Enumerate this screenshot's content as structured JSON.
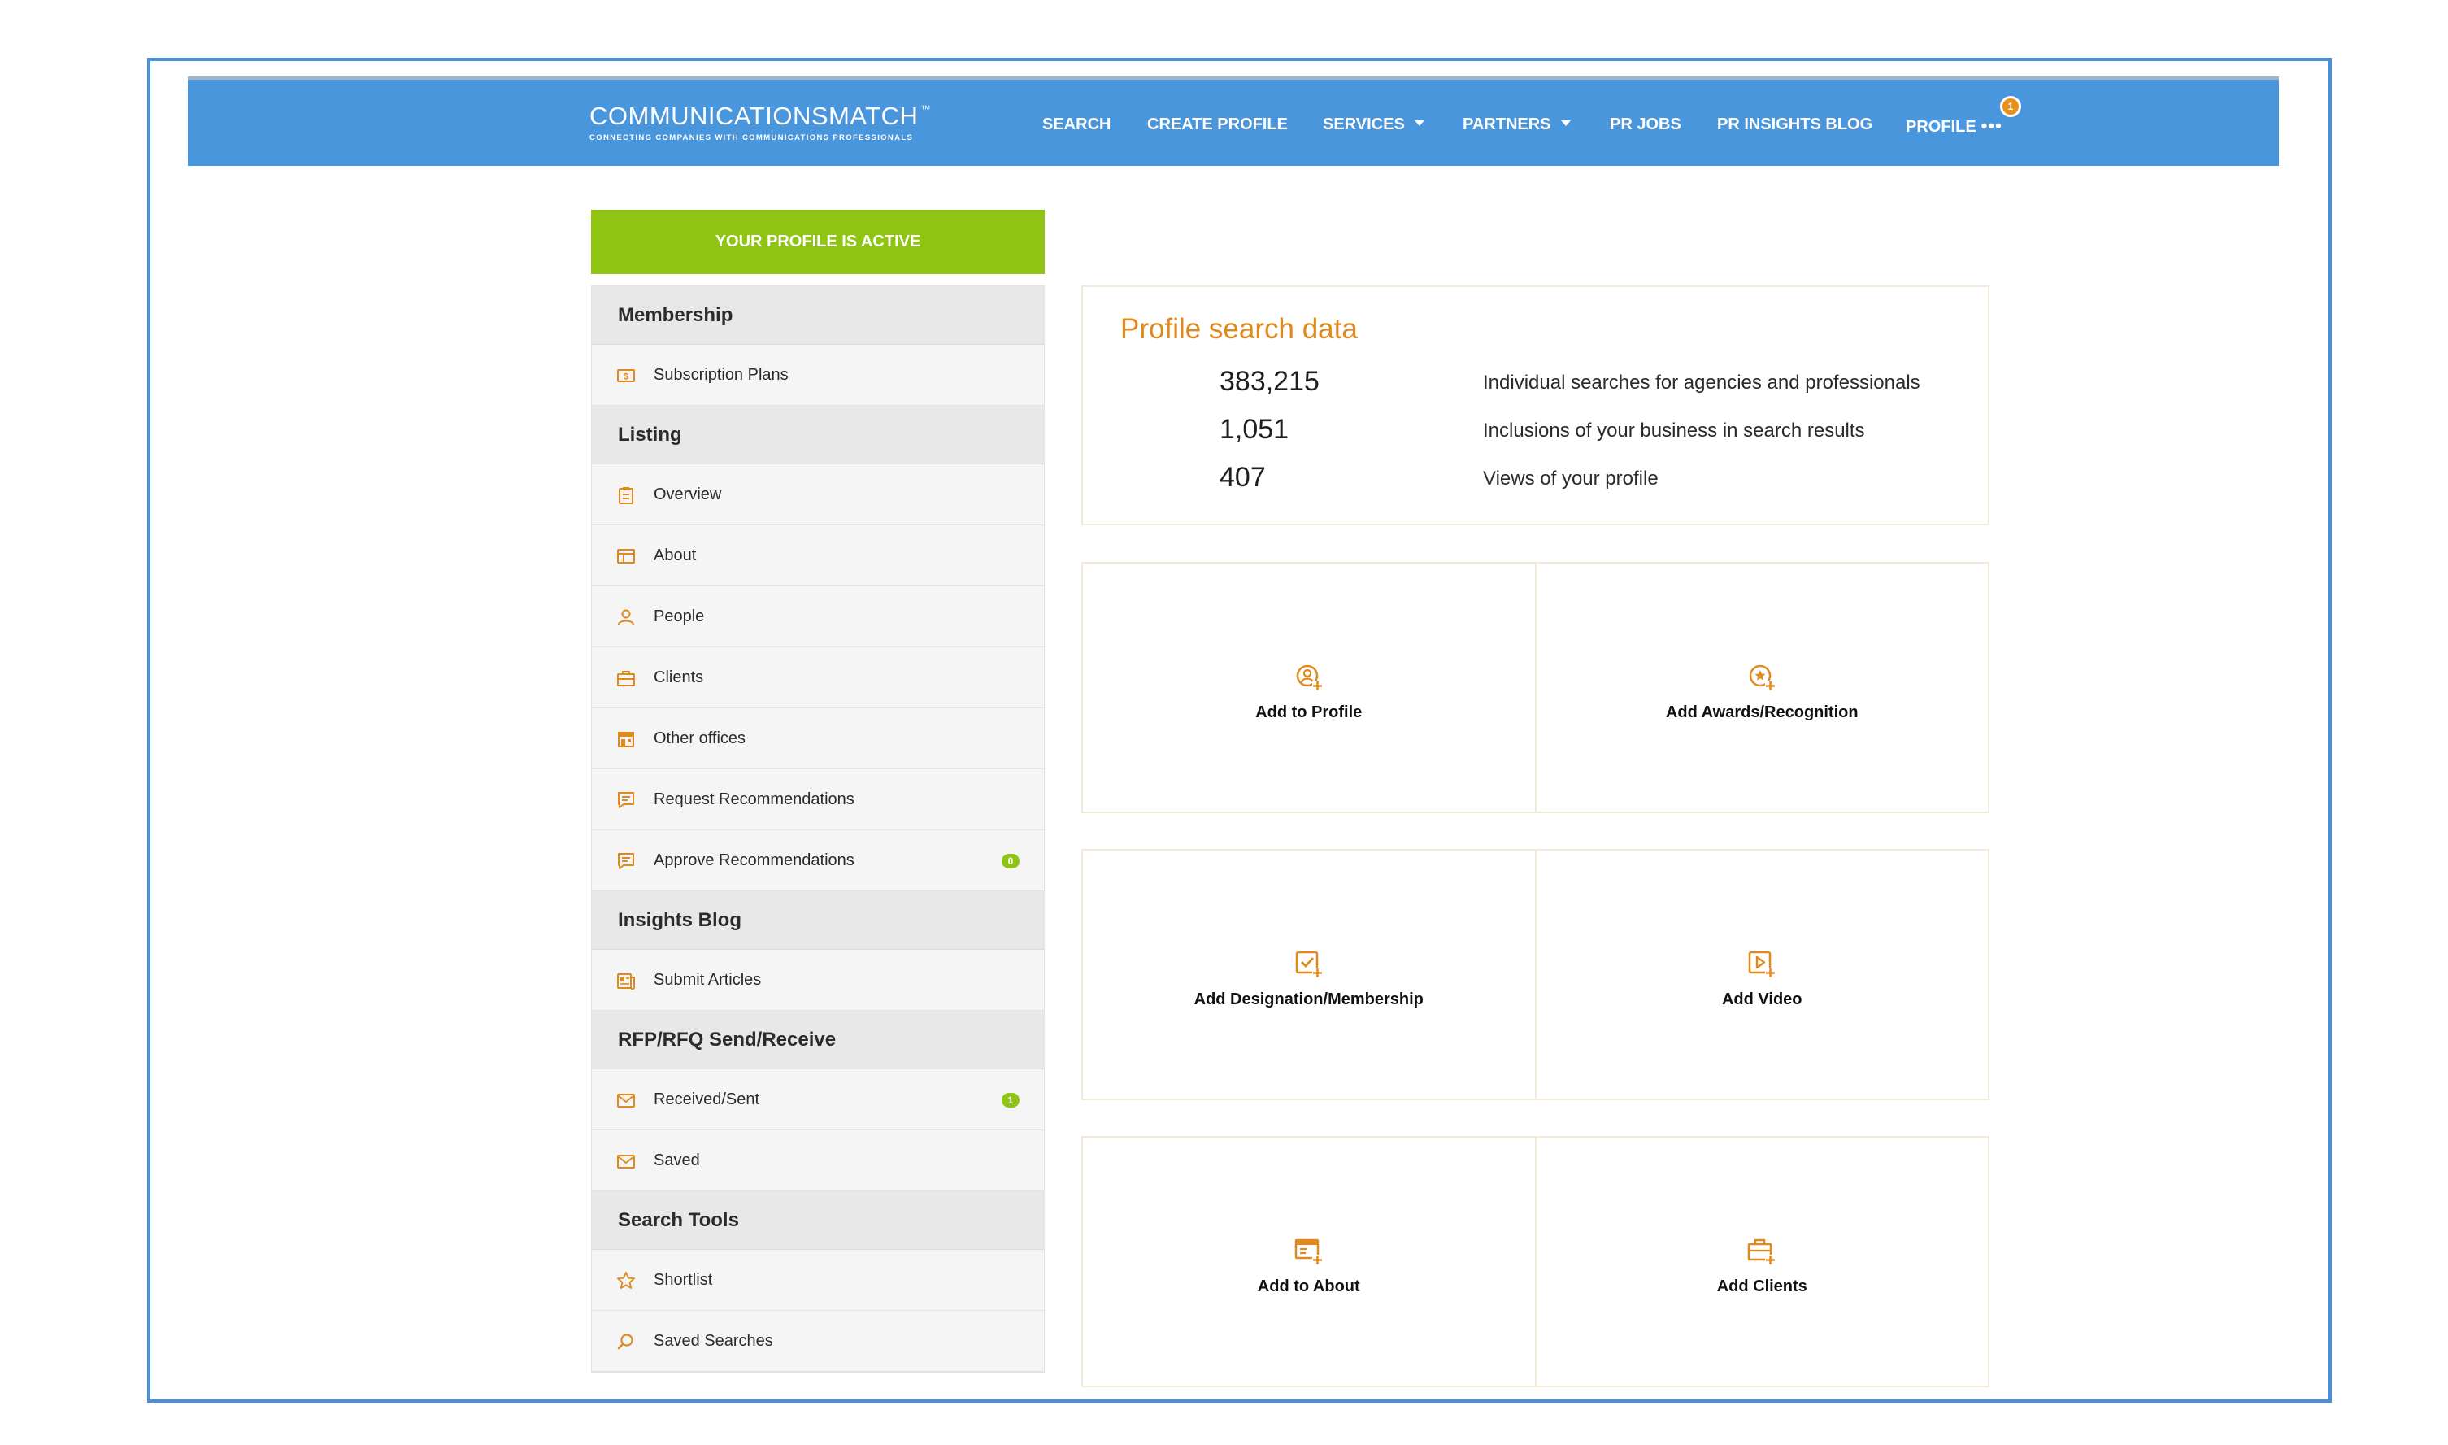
{
  "header": {
    "logo_text": "COMMUNICATIONSMATCH",
    "logo_tm": "™",
    "logo_tagline": "CONNECTING COMPANIES WITH COMMUNICATIONS PROFESSIONALS",
    "nav": {
      "search": "SEARCH",
      "create_profile": "CREATE PROFILE",
      "services": "SERVICES",
      "partners": "PARTNERS",
      "pr_jobs": "PR JOBS",
      "blog": "PR INSIGHTS BLOG",
      "profile": "PROFILE",
      "profile_dots": "•••",
      "notification_count": "1"
    }
  },
  "profile_status": "YOUR PROFILE IS ACTIVE",
  "sidebar": {
    "membership": {
      "title": "Membership",
      "items": [
        {
          "label": "Subscription Plans",
          "icon": "dollar-icon"
        }
      ]
    },
    "listing": {
      "title": "Listing",
      "items": [
        {
          "label": "Overview",
          "icon": "clipboard-icon"
        },
        {
          "label": "About",
          "icon": "window-icon"
        },
        {
          "label": "People",
          "icon": "person-icon"
        },
        {
          "label": "Clients",
          "icon": "briefcase-icon"
        },
        {
          "label": "Other offices",
          "icon": "building-icon"
        },
        {
          "label": "Request Recommendations",
          "icon": "chat-icon"
        },
        {
          "label": "Approve Recommendations",
          "icon": "chat-icon",
          "badge": "0"
        }
      ]
    },
    "insights": {
      "title": "Insights Blog",
      "items": [
        {
          "label": "Submit Articles",
          "icon": "article-icon"
        }
      ]
    },
    "rfp": {
      "title": "RFP/RFQ Send/Receive",
      "items": [
        {
          "label": "Received/Sent",
          "icon": "envelope-icon",
          "badge": "1"
        },
        {
          "label": "Saved",
          "icon": "envelope-icon"
        }
      ]
    },
    "search_tools": {
      "title": "Search Tools",
      "items": [
        {
          "label": "Shortlist",
          "icon": "star-icon"
        },
        {
          "label": "Saved Searches",
          "icon": "search-icon"
        }
      ]
    }
  },
  "stats": {
    "title": "Profile search data",
    "rows": [
      {
        "value": "383,215",
        "label": "Individual searches for agencies and professionals"
      },
      {
        "value": "1,051",
        "label": "Inclusions of your business in search results"
      },
      {
        "value": "407",
        "label": "Views of your profile"
      }
    ]
  },
  "cards": [
    {
      "label": "Add to Profile",
      "icon": "profile-add-icon"
    },
    {
      "label": "Add Awards/Recognition",
      "icon": "award-add-icon"
    },
    {
      "label": "Add Designation/Membership",
      "icon": "checkbox-add-icon"
    },
    {
      "label": "Add Video",
      "icon": "video-add-icon"
    },
    {
      "label": "Add to About",
      "icon": "window-add-icon"
    },
    {
      "label": "Add Clients",
      "icon": "briefcase-add-icon"
    }
  ],
  "colors": {
    "accent": "#e08a1e",
    "nav_bg": "#4a96dd",
    "active_green": "#8fc412"
  }
}
